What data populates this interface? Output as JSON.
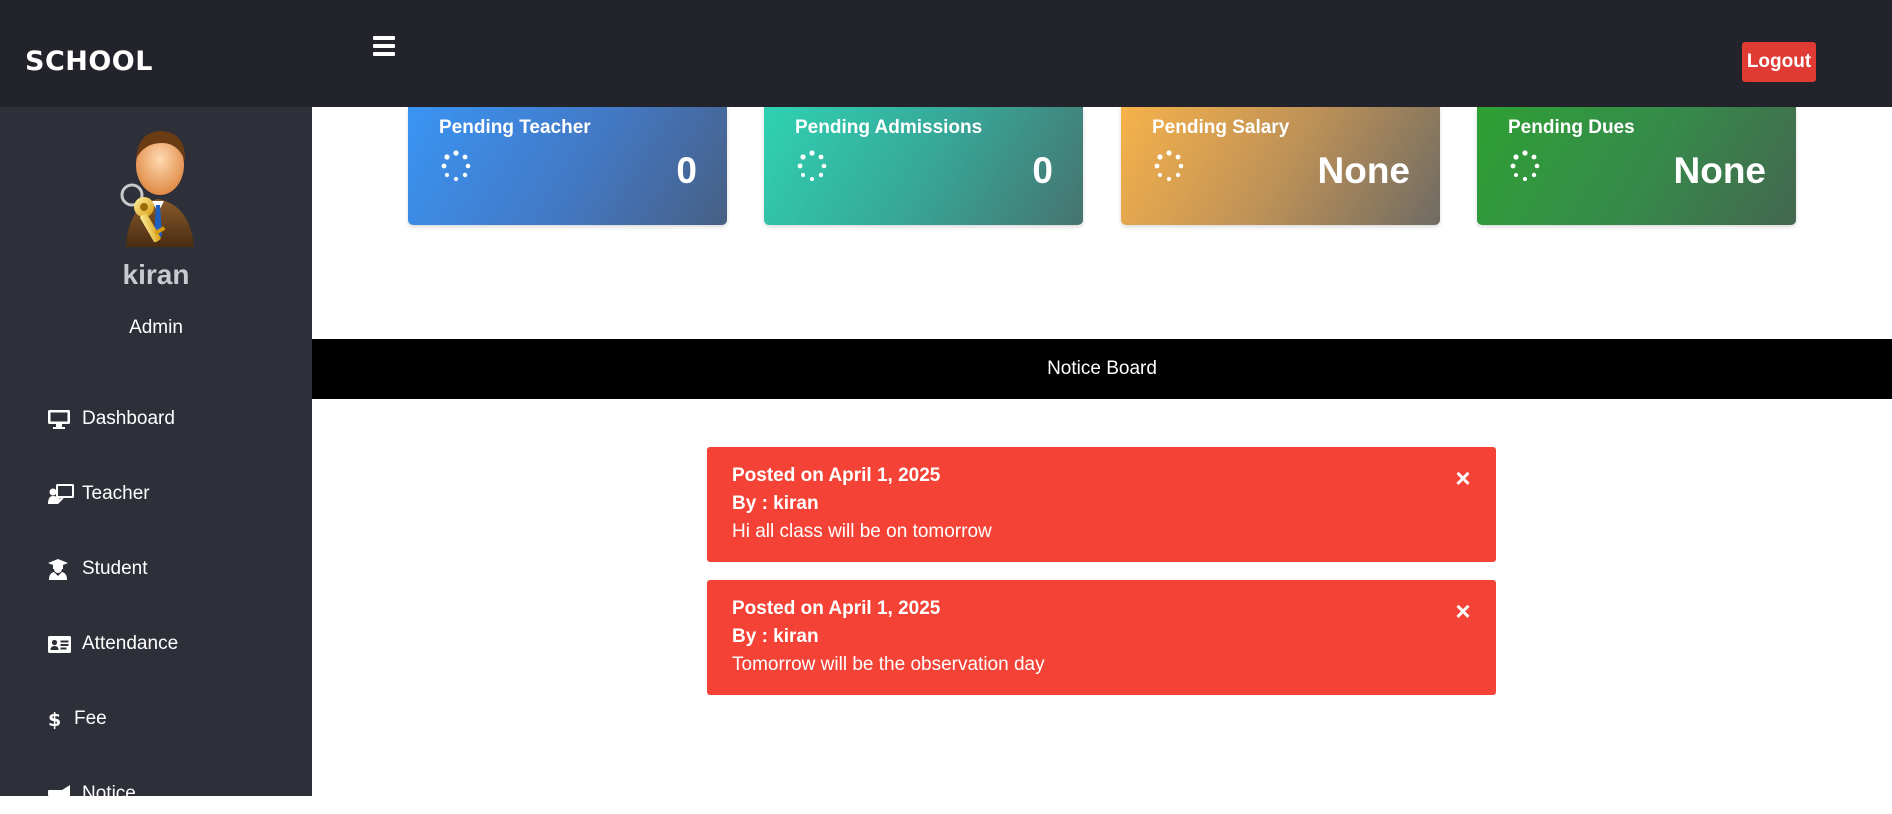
{
  "header": {
    "brand": "SCHOOL",
    "menu_icon": "hamburger-menu-icon",
    "logout_label": "Logout",
    "logout_color": "#e03a34"
  },
  "sidebar": {
    "avatar_icon": "admin-key-avatar",
    "username": "kiran",
    "role": "Admin",
    "items": [
      {
        "label": "Dashboard",
        "icon": "desktop-icon"
      },
      {
        "label": "Teacher",
        "icon": "chalkboard-teacher-icon"
      },
      {
        "label": "Student",
        "icon": "graduate-icon"
      },
      {
        "label": "Attendance",
        "icon": "id-card-icon"
      },
      {
        "label": "Fee",
        "icon": "dollar-icon"
      },
      {
        "label": "Notice",
        "icon": "megaphone-icon"
      }
    ]
  },
  "cards": [
    {
      "title": "Pending Teacher",
      "value": "0",
      "icon": "spinner-icon"
    },
    {
      "title": "Pending Admissions",
      "value": "0",
      "icon": "spinner-icon"
    },
    {
      "title": "Pending Salary",
      "value": "None",
      "icon": "spinner-icon"
    },
    {
      "title": "Pending Dues",
      "value": "None",
      "icon": "spinner-icon"
    }
  ],
  "notice_board": {
    "title": "Notice Board",
    "notices": [
      {
        "posted": "Posted on April 1, 2025",
        "by": "By : kiran",
        "message": "Hi all class will be on tomorrow",
        "close_symbol": "×"
      },
      {
        "posted": "Posted on April 1, 2025",
        "by": "By : kiran",
        "message": "Tomorrow will be the observation day",
        "close_symbol": "×"
      }
    ],
    "notice_color": "#f44336"
  }
}
